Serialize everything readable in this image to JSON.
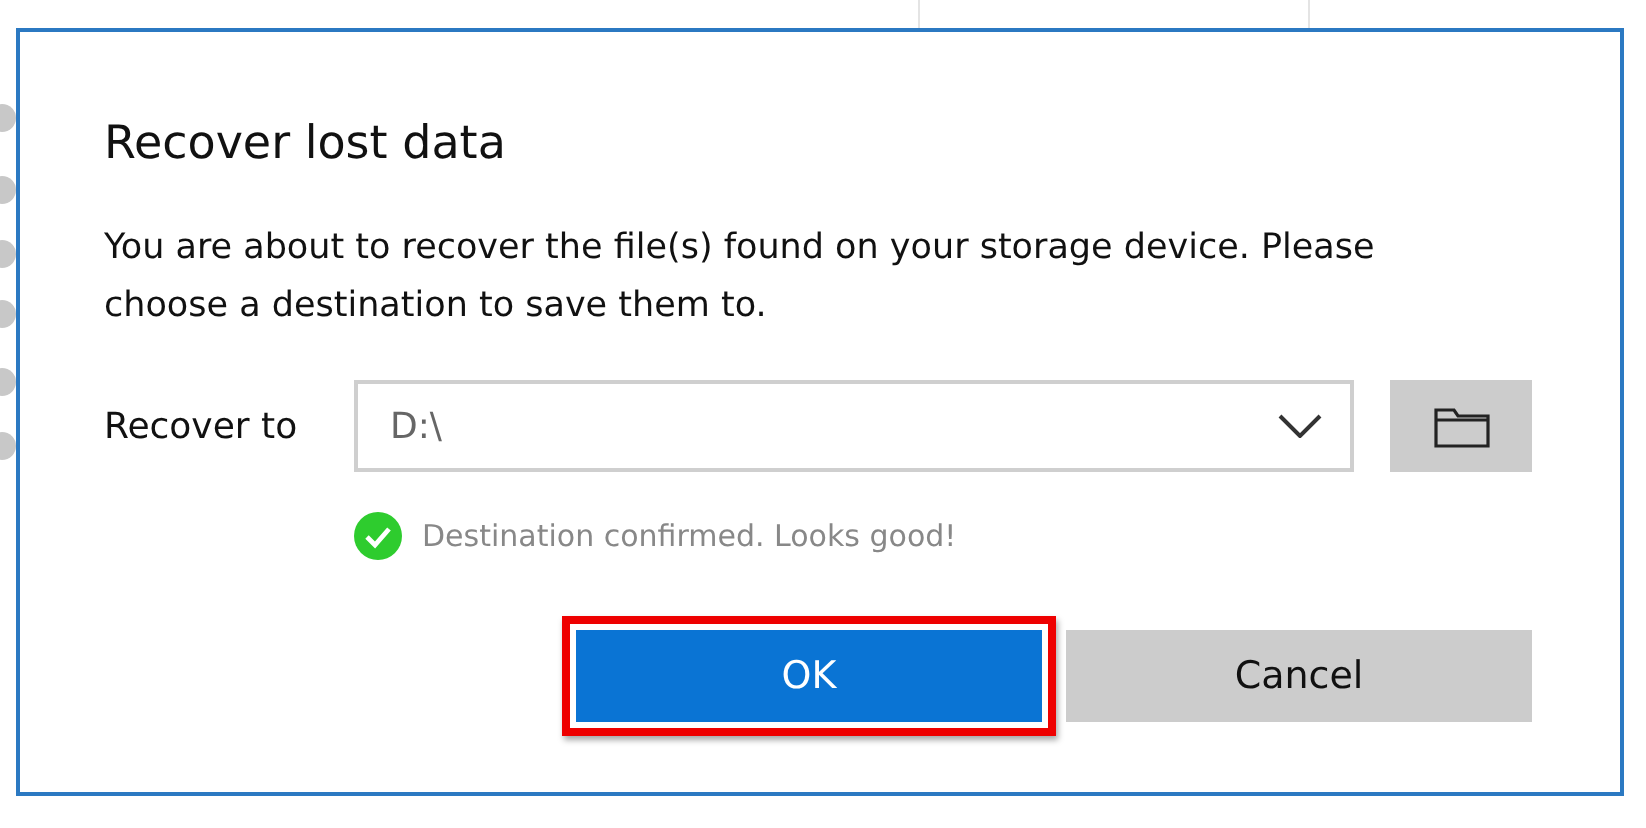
{
  "dialog": {
    "title": "Recover lost data",
    "message": "You are about to recover the file(s) found on your storage device. Please choose a destination to save them to.",
    "destination": {
      "label": "Recover to",
      "value": "D:\\"
    },
    "status": {
      "kind": "success",
      "text": "Destination confirmed. Looks good!"
    },
    "buttons": [
      {
        "label": "OK",
        "kind": "primary",
        "highlighted": true
      },
      {
        "label": "Cancel",
        "kind": "secondary",
        "highlighted": false
      }
    ]
  }
}
